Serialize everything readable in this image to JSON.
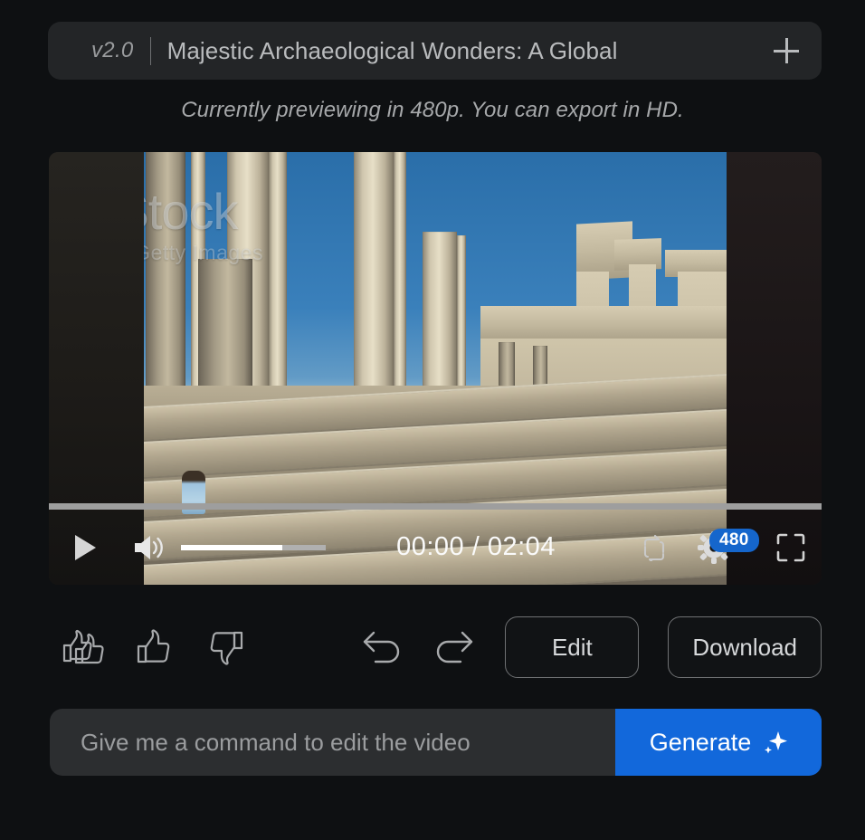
{
  "window": {
    "background_color": "#0e1012"
  },
  "titlebar": {
    "version": "v2.0",
    "project_title": "Majestic Archaeological Wonders: A Global",
    "add_icon": "plus-icon",
    "background_color": "#232527"
  },
  "notice": {
    "text": "Currently previewing in 480p. You can export in HD."
  },
  "video": {
    "watermark_primary": "iStock",
    "watermark_secondary": "by Getty Images",
    "scene_description": "Ancient Greek temple ruins with stone columns against blue sky",
    "progress_percent": 0,
    "controls": {
      "play_icon": "play-icon",
      "volume_icon": "volume-on-icon",
      "volume_percent": 70,
      "time_current": "00:00",
      "time_separator": "/",
      "time_total": "02:04",
      "time_display": "00:00 / 02:04",
      "loop_icon": "loop-icon",
      "settings_icon": "gear-icon",
      "quality_badge": "480",
      "quality_badge_color": "#1566cc",
      "fullscreen_icon": "fullscreen-icon"
    }
  },
  "actions": {
    "double_thumbs_up_icon": "double-thumbs-up-icon",
    "thumbs_up_icon": "thumbs-up-icon",
    "thumbs_down_icon": "thumbs-down-icon",
    "undo_icon": "undo-icon",
    "redo_icon": "redo-icon",
    "edit_label": "Edit",
    "download_label": "Download"
  },
  "prompt": {
    "placeholder": "Give me a command to edit the video",
    "value": "",
    "generate_label": "Generate",
    "generate_icon": "sparkle-icon",
    "generate_color": "#1268db"
  }
}
